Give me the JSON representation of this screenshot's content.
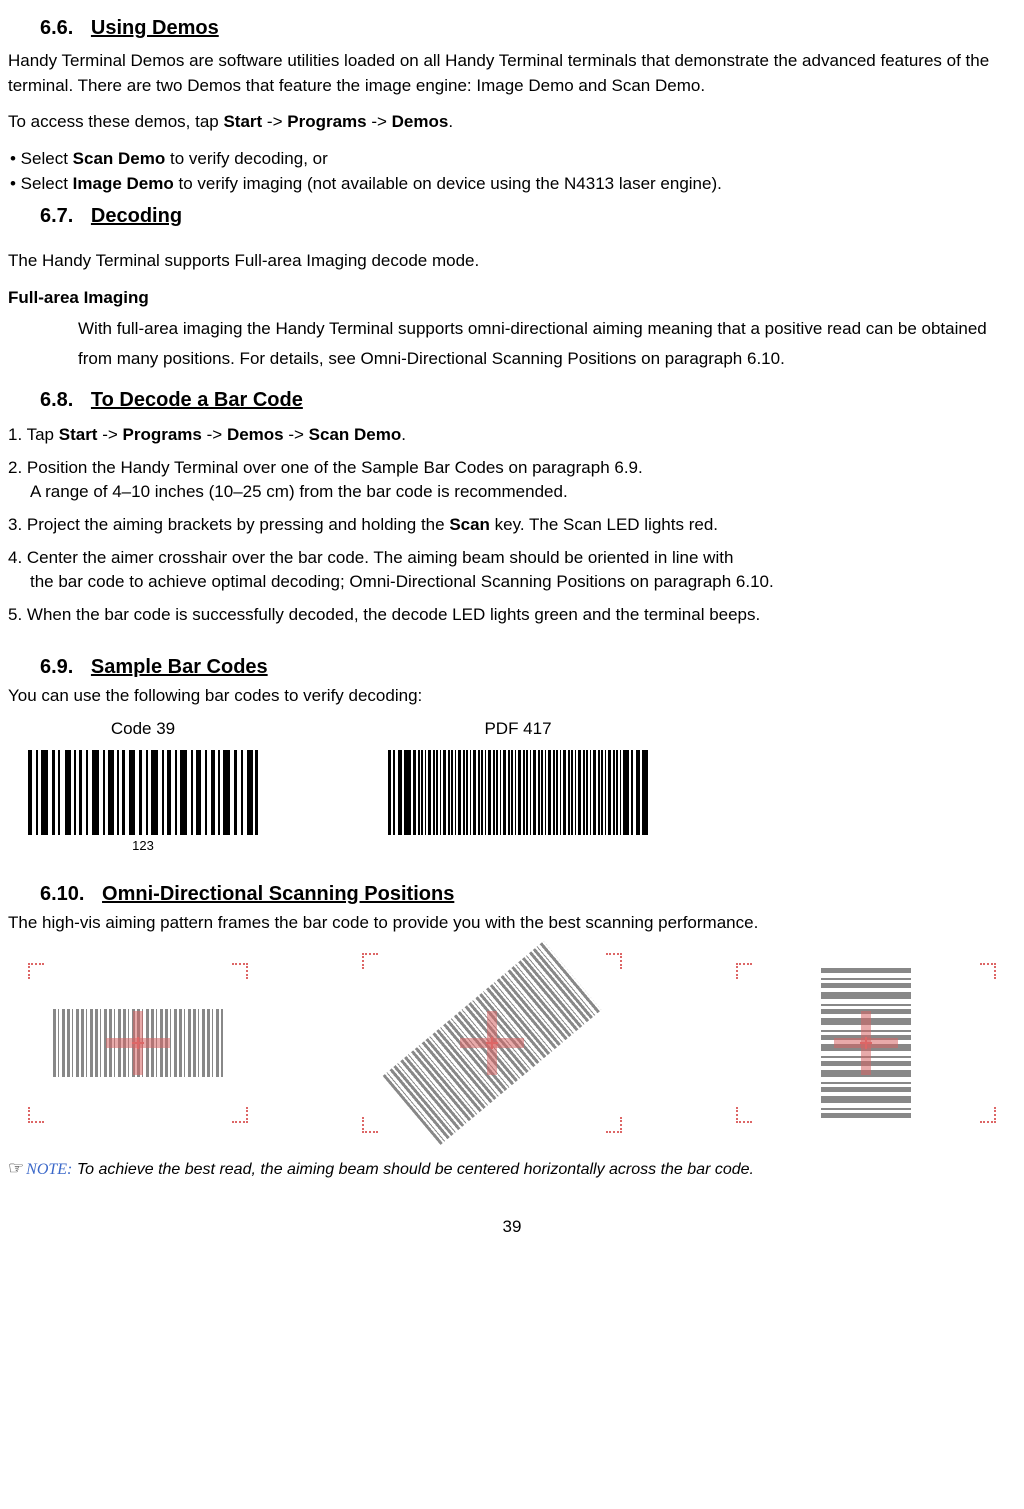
{
  "sections": {
    "s66": {
      "num": "6.6.",
      "title": "Using Demos"
    },
    "s67": {
      "num": "6.7.",
      "title": "Decoding"
    },
    "s68": {
      "num": "6.8.",
      "title": "To Decode a Bar Code"
    },
    "s69": {
      "num": "6.9.",
      "title": "Sample Bar Codes"
    },
    "s610": {
      "num": "6.10.",
      "title": "Omni-Directional Scanning Positions"
    }
  },
  "s66_body": {
    "p1": "Handy Terminal Demos are software utilities loaded on all Handy Terminal terminals that demonstrate the advanced features of the terminal. There are two Demos that feature the image engine: Image Demo and Scan Demo.",
    "p2_a": "To access these demos, tap ",
    "p2_b": "Start",
    "p2_c": " -> ",
    "p2_d": "Programs",
    "p2_e": " -> ",
    "p2_f": "Demos",
    "p2_g": ".",
    "b1_a": "• Select ",
    "b1_b": "Scan Demo",
    "b1_c": " to verify decoding, or",
    "b2_a": "• Select ",
    "b2_b": "Image Demo",
    "b2_c": " to verify imaging (not available on device using the N4313 laser engine)."
  },
  "s67_body": {
    "p1": "The Handy Terminal supports Full-area Imaging decode mode.",
    "sub": "Full-area Imaging",
    "p2": "With full-area imaging the Handy Terminal supports omni-directional aiming meaning that a positive read can be obtained from many positions. For details, see Omni-Directional Scanning Positions on paragraph 6.10."
  },
  "s68_body": {
    "step1_a": "1. Tap ",
    "step1_b": "Start",
    "step1_c": " -> ",
    "step1_d": "Programs",
    "step1_e": " -> ",
    "step1_f": "Demos",
    "step1_g": " -> ",
    "step1_h": "Scan Demo",
    "step1_i": ".",
    "step2_l1": "2. Position the Handy Terminal over one of the Sample Bar Codes on paragraph 6.9.",
    "step2_l2": "A range of 4–10 inches (10–25 cm) from the bar code is recommended.",
    "step3_a": "3. Project the aiming brackets by pressing and holding the ",
    "step3_b": "Scan",
    "step3_c": " key. The Scan LED lights red.",
    "step4_l1": "4. Center the aimer crosshair over the bar code. The aiming beam should be oriented in line with",
    "step4_l2": "the bar code to achieve optimal decoding; Omni-Directional Scanning Positions on paragraph 6.10.",
    "step5": "5. When the bar code is successfully decoded, the decode LED lights green and the terminal beeps."
  },
  "s69_body": {
    "intro": "You can use the following bar codes to verify decoding:",
    "label1": "Code 39",
    "label2": "PDF 417",
    "code39_value": "123"
  },
  "s610_body": {
    "intro": "The high-vis aiming pattern frames the bar code to provide you with the best scanning performance."
  },
  "note": {
    "hand": "☞",
    "label": "NOTE:",
    "text": "To achieve the best read, the aiming beam should be centered horizontally across the bar code."
  },
  "page_number": "39"
}
